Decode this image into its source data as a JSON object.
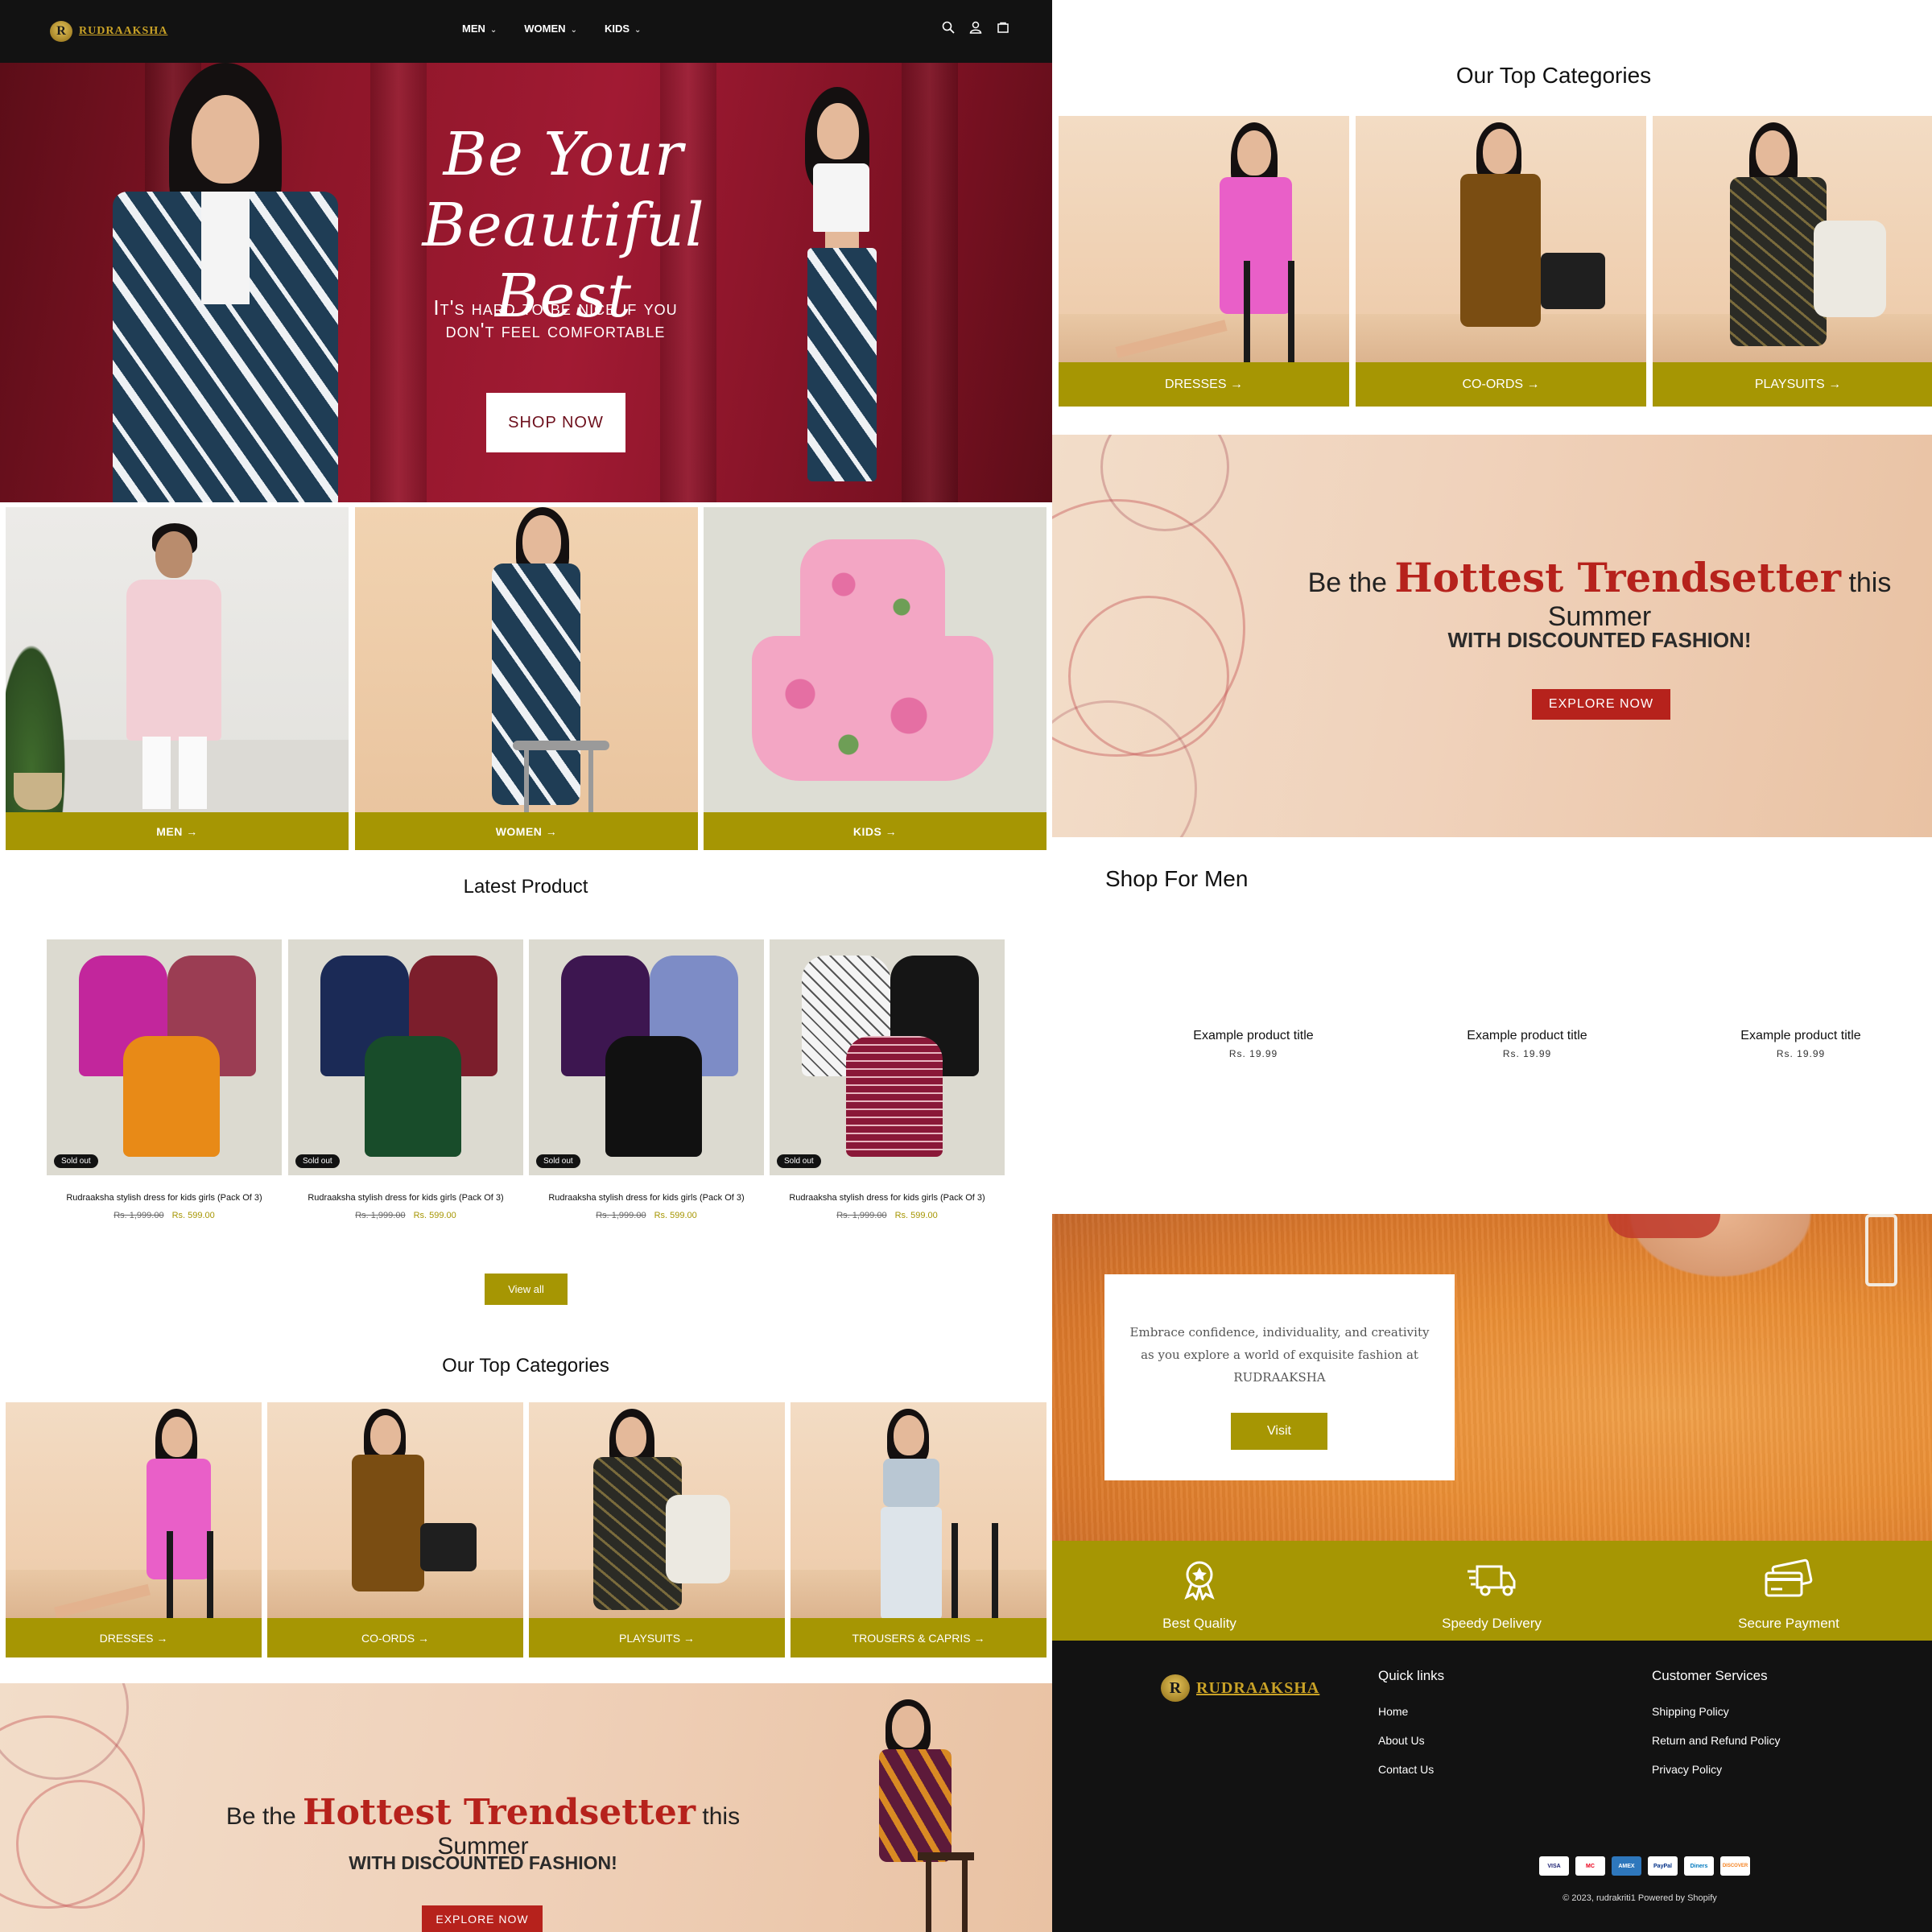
{
  "header": {
    "logo_text": "RUDRAAKSHA",
    "logo_crest": "R",
    "nav": [
      {
        "label": "MEN"
      },
      {
        "label": "WOMEN"
      },
      {
        "label": "KIDS"
      }
    ],
    "icons": [
      "search-icon",
      "account-icon",
      "cart-icon"
    ]
  },
  "hero": {
    "title_line1": "Be Your",
    "title_line2": "Beautiful Best",
    "subtitle_line1": "It's hard to be nice if you",
    "subtitle_line2": "don't feel comfortable",
    "button": "SHOP NOW"
  },
  "collections": [
    {
      "label": "MEN →"
    },
    {
      "label": "WOMEN →"
    },
    {
      "label": "KIDS →"
    }
  ],
  "latest": {
    "title": "Latest Product",
    "products": [
      {
        "badge": "Sold out",
        "title": "Rudraaksha stylish dress for kids girls (Pack Of 3)",
        "old_price": "Rs. 1,999.00",
        "price": "Rs. 599.00"
      },
      {
        "badge": "Sold out",
        "title": "Rudraaksha stylish dress for kids girls (Pack Of 3)",
        "old_price": "Rs. 1,999.00",
        "price": "Rs. 599.00"
      },
      {
        "badge": "Sold out",
        "title": "Rudraaksha stylish dress for kids girls (Pack Of 3)",
        "old_price": "Rs. 1,999.00",
        "price": "Rs. 599.00"
      },
      {
        "badge": "Sold out",
        "title": "Rudraaksha stylish dress for kids girls (Pack Of 3)",
        "old_price": "Rs. 1,999.00",
        "price": "Rs. 599.00"
      }
    ],
    "view_all": "View all"
  },
  "top_categories": {
    "title": "Our Top Categories",
    "items": [
      {
        "label": "DRESSES →"
      },
      {
        "label": "CO-ORDS →"
      },
      {
        "label": "PLAYSUITS →"
      },
      {
        "label": "TROUSERS & CAPRIS →"
      }
    ]
  },
  "promo": {
    "prefix": "Be the",
    "highlight": "Hottest Trendsetter",
    "suffix": "this Summer",
    "line2": "WITH DISCOUNTED FASHION!",
    "button": "EXPLORE NOW"
  },
  "right_categories": {
    "title": "Our Top Categories",
    "items": [
      {
        "label": "DRESSES →"
      },
      {
        "label": "CO-ORDS →"
      },
      {
        "label": "PLAYSUITS →"
      }
    ]
  },
  "shop_men": {
    "title": "Shop For Men",
    "products": [
      {
        "title": "Example product title",
        "price": "Rs. 19.99"
      },
      {
        "title": "Example product title",
        "price": "Rs. 19.99"
      },
      {
        "title": "Example product title",
        "price": "Rs. 19.99"
      }
    ]
  },
  "banner": {
    "text": "Embrace confidence, individuality, and creativity as you explore a world of exquisite fashion at RUDRAAKSHA",
    "button": "Visit"
  },
  "features": [
    {
      "icon": "award-icon",
      "label": "Best Quality"
    },
    {
      "icon": "delivery-truck-icon",
      "label": "Speedy Delivery"
    },
    {
      "icon": "credit-card-icon",
      "label": "Secure Payment"
    }
  ],
  "footer": {
    "logo_text": "RUDRAAKSHA",
    "quick_links_title": "Quick links",
    "quick_links": [
      "Home",
      "About Us",
      "Contact Us"
    ],
    "customer_title": "Customer Services",
    "customer_links": [
      "Shipping Policy",
      "Return and Refund Policy",
      "Privacy Policy"
    ],
    "payments": [
      "VISA",
      "MC",
      "AMEX",
      "PayPal",
      "Diners",
      "DISCOVER"
    ],
    "copyright": "© 2023, rudrakriti1 Powered by Shopify"
  },
  "colors": {
    "olive": "#a69603",
    "dark": "#121212",
    "hero_red": "#a11a33",
    "promo_red": "#b6221c"
  }
}
